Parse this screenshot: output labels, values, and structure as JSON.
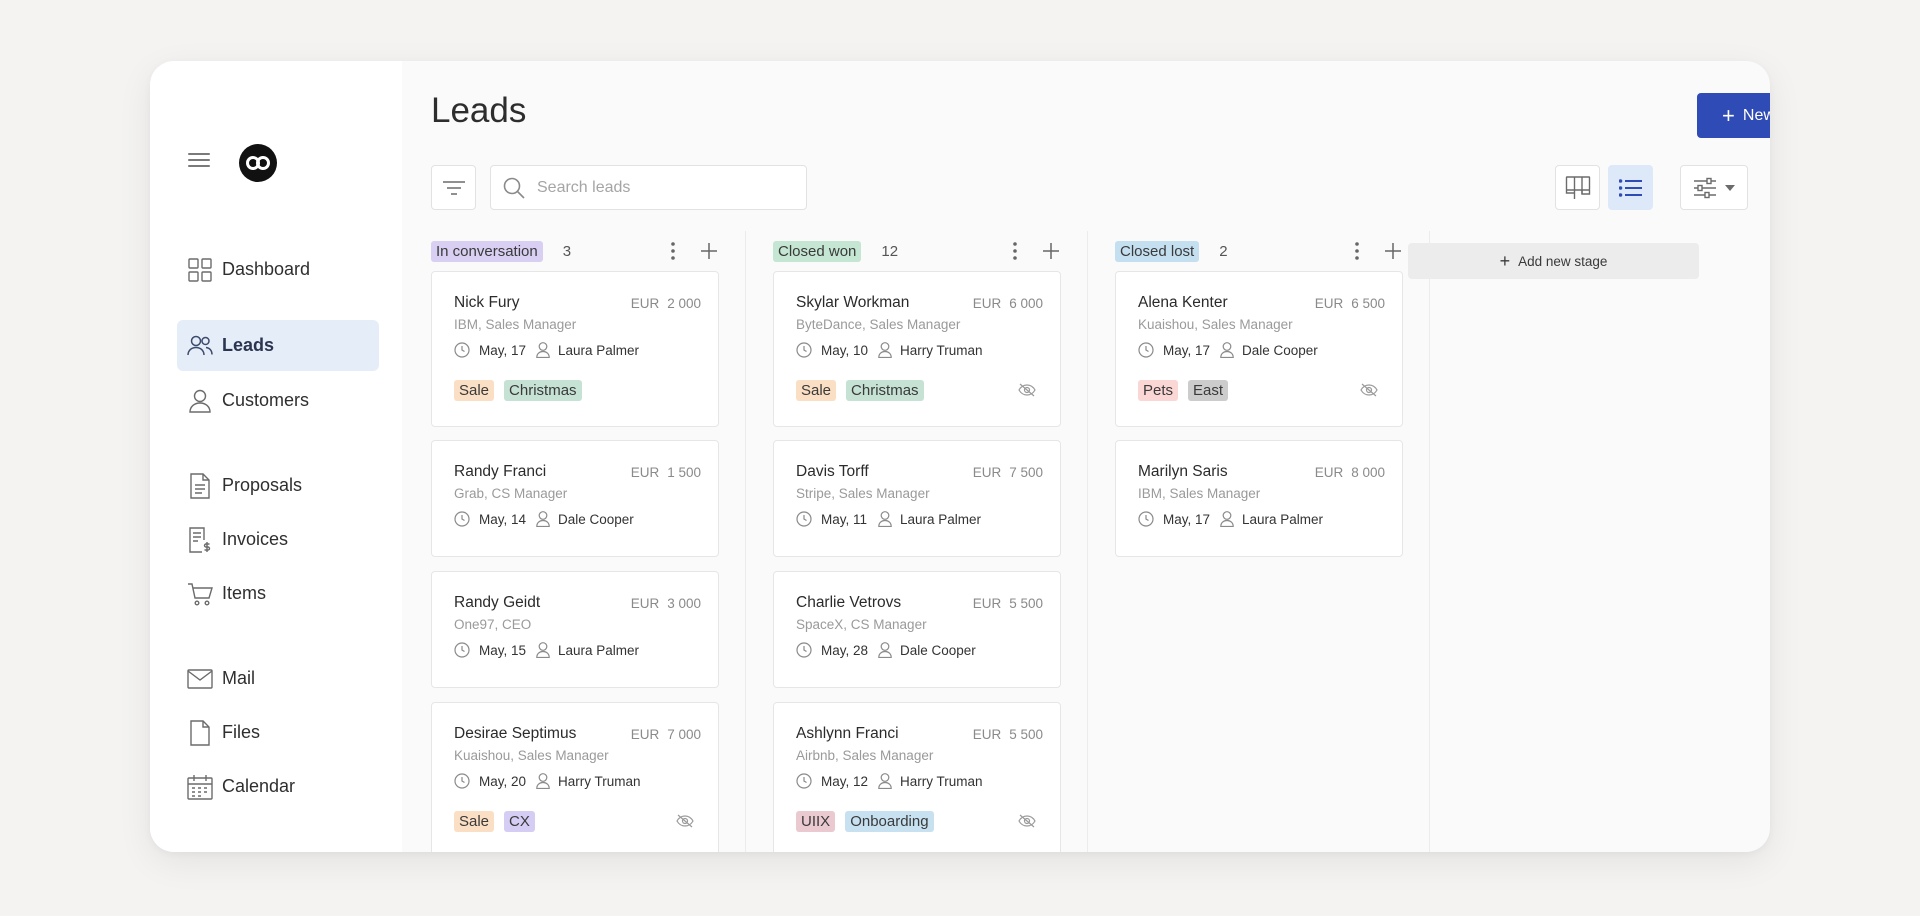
{
  "colors": {
    "accent": "#2f4bb5",
    "active_nav_bg": "#e5eef8",
    "stage_in_conversation": "#d9cff3",
    "stage_closed_won": "#c4e6d2",
    "stage_closed_lost": "#c4dff0",
    "tag_sale": "#fbdfc4",
    "tag_christmas": "#c6e2d5",
    "tag_cx": "#d5cdf3",
    "tag_pets": "#fad6d4",
    "tag_east": "#cccccc",
    "tag_uiix": "#eac9d1",
    "tag_onboarding": "#c7e1f1"
  },
  "sidebar": {
    "items": [
      {
        "label": "Dashboard",
        "icon": "dashboard-icon"
      },
      {
        "label": "Leads",
        "icon": "users-icon",
        "active": true
      },
      {
        "label": "Customers",
        "icon": "user-icon"
      },
      {
        "label": "Proposals",
        "icon": "document-icon"
      },
      {
        "label": "Invoices",
        "icon": "invoice-icon"
      },
      {
        "label": "Items",
        "icon": "cart-icon"
      },
      {
        "label": "Mail",
        "icon": "mail-icon"
      },
      {
        "label": "Files",
        "icon": "file-icon"
      },
      {
        "label": "Calendar",
        "icon": "calendar-icon"
      }
    ]
  },
  "header": {
    "title": "Leads",
    "new_lead_label": "New Lead"
  },
  "search": {
    "placeholder": "Search leads",
    "value": ""
  },
  "add_stage_label": "Add new stage",
  "columns": [
    {
      "stage": "In conversation",
      "count": "3",
      "cards": [
        {
          "name": "Nick Fury",
          "currency": "EUR",
          "amount": "2 000",
          "company": "IBM, Sales Manager",
          "date": "May, 17",
          "owner": "Laura Palmer",
          "tags": [
            "Sale",
            "Christmas"
          ],
          "hidden_icon": false
        },
        {
          "name": "Randy Franci",
          "currency": "EUR",
          "amount": "1 500",
          "company": "Grab, CS Manager",
          "date": "May, 14",
          "owner": "Dale Cooper",
          "tags": [],
          "hidden_icon": false
        },
        {
          "name": "Randy Geidt",
          "currency": "EUR",
          "amount": "3 000",
          "company": "One97, CEO",
          "date": "May, 15",
          "owner": "Laura Palmer",
          "tags": [],
          "hidden_icon": false
        },
        {
          "name": "Desirae Septimus",
          "currency": "EUR",
          "amount": "7 000",
          "company": "Kuaishou, Sales Manager",
          "date": "May, 20",
          "owner": "Harry Truman",
          "tags": [
            "Sale",
            "CX"
          ],
          "hidden_icon": true
        }
      ]
    },
    {
      "stage": "Closed won",
      "count": "12",
      "cards": [
        {
          "name": "Skylar Workman",
          "currency": "EUR",
          "amount": "6 000",
          "company": "ByteDance, Sales Manager",
          "date": "May, 10",
          "owner": "Harry Truman",
          "tags": [
            "Sale",
            "Christmas"
          ],
          "hidden_icon": true
        },
        {
          "name": "Davis Torff",
          "currency": "EUR",
          "amount": "7 500",
          "company": "Stripe, Sales Manager",
          "date": "May, 11",
          "owner": "Laura Palmer",
          "tags": [],
          "hidden_icon": false
        },
        {
          "name": "Charlie Vetrovs",
          "currency": "EUR",
          "amount": "5 500",
          "company": "SpaceX, CS Manager",
          "date": "May, 28",
          "owner": "Dale Cooper",
          "tags": [],
          "hidden_icon": false
        },
        {
          "name": "Ashlynn Franci",
          "currency": "EUR",
          "amount": "5 500",
          "company": "Airbnb, Sales Manager",
          "date": "May, 12",
          "owner": "Harry Truman",
          "tags": [
            "UIIX",
            "Onboarding"
          ],
          "hidden_icon": true
        }
      ]
    },
    {
      "stage": "Closed lost",
      "count": "2",
      "cards": [
        {
          "name": "Alena Kenter",
          "currency": "EUR",
          "amount": "6 500",
          "company": "Kuaishou, Sales Manager",
          "date": "May, 17",
          "owner": "Dale Cooper",
          "tags": [
            "Pets",
            "East"
          ],
          "hidden_icon": true
        },
        {
          "name": "Marilyn Saris",
          "currency": "EUR",
          "amount": "8 000",
          "company": "IBM, Sales Manager",
          "date": "May, 17",
          "owner": "Laura Palmer",
          "tags": [],
          "hidden_icon": false
        }
      ]
    }
  ]
}
